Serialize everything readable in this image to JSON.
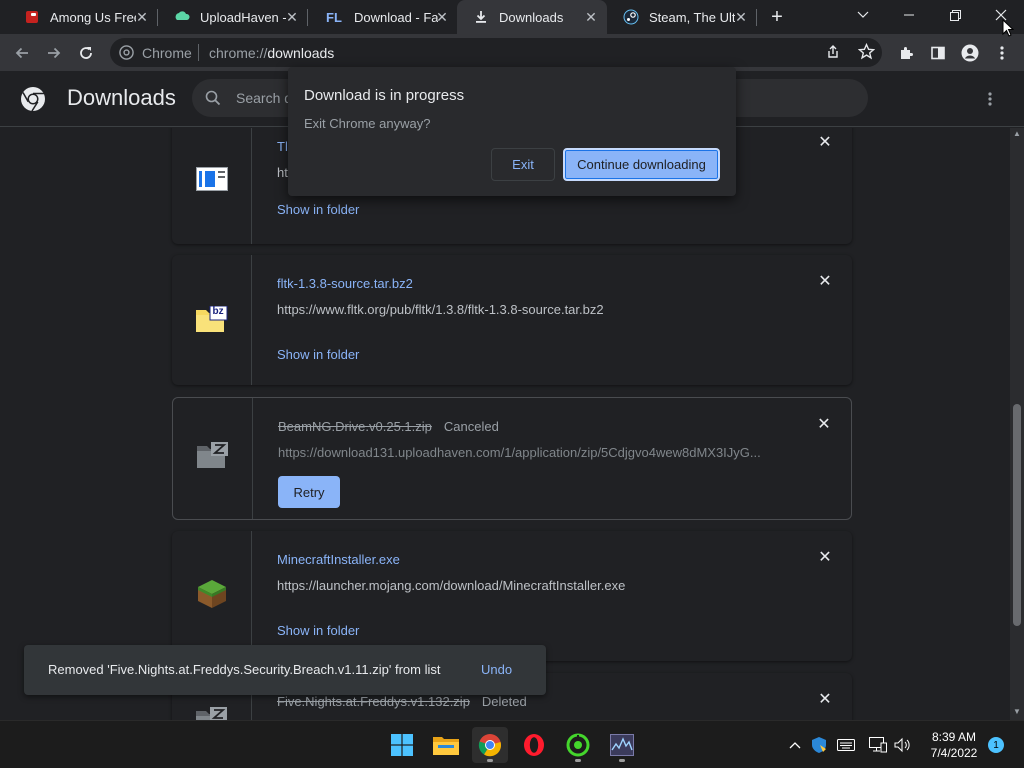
{
  "tabs": [
    {
      "title": "Among Us Free",
      "icon": "among-us-icon"
    },
    {
      "title": "UploadHaven -",
      "icon": "uploadhaven-icon"
    },
    {
      "title": "Download - Fas",
      "icon": "fl-icon",
      "icon_text": "FL"
    },
    {
      "title": "Downloads",
      "icon": "download-icon",
      "active": true
    },
    {
      "title": "Steam, The Ultir",
      "icon": "steam-icon"
    }
  ],
  "new_tab_symbol": "+",
  "toolbar": {
    "chip_label": "Chrome",
    "url_scheme": "chrome://",
    "url_host": "downloads"
  },
  "page": {
    "title": "Downloads",
    "search_placeholder": "Search downloads"
  },
  "downloads": [
    {
      "name": "Tl",
      "url": "ht",
      "action": "Show in folder",
      "icon": "file-window-icon"
    },
    {
      "name": "fltk-1.3.8-source.tar.bz2",
      "url": "https://www.fltk.org/pub/fltk/1.3.8/fltk-1.3.8-source.tar.bz2",
      "action": "Show in folder",
      "icon": "bz2-archive-icon",
      "icon_text": "bz"
    },
    {
      "name": "BeamNG.Drive.v0.25.1.zip",
      "status": "Canceled",
      "url": "https://download131.uploadhaven.com/1/application/zip/5Cdjgvo4wew8dMX3IJyG...",
      "action": "Retry",
      "icon": "zip-archive-icon"
    },
    {
      "name": "MinecraftInstaller.exe",
      "url": "https://launcher.mojang.com/download/MinecraftInstaller.exe",
      "action": "Show in folder",
      "icon": "minecraft-grass-block-icon"
    },
    {
      "name": "Five.Nights.at.Freddys.v1.132.zip",
      "status": "Deleted",
      "icon": "zip-archive-icon"
    }
  ],
  "dialog": {
    "title": "Download is in progress",
    "message": "Exit Chrome anyway?",
    "exit_label": "Exit",
    "continue_label": "Continue downloading"
  },
  "toast": {
    "message": "Removed 'Five.Nights.at.Freddys.Security.Breach.v1.11.zip' from list",
    "undo_label": "Undo"
  },
  "taskbar": {
    "apps": [
      "windows-start-icon",
      "file-explorer-icon",
      "chrome-icon",
      "opera-icon",
      "razer-cortex-icon",
      "task-manager-icon"
    ],
    "time": "8:39 AM",
    "date": "7/4/2022",
    "notification_count": "1"
  },
  "colors": {
    "accent": "#8ab4f8",
    "background": "#202124",
    "toolbar": "#35363a"
  }
}
